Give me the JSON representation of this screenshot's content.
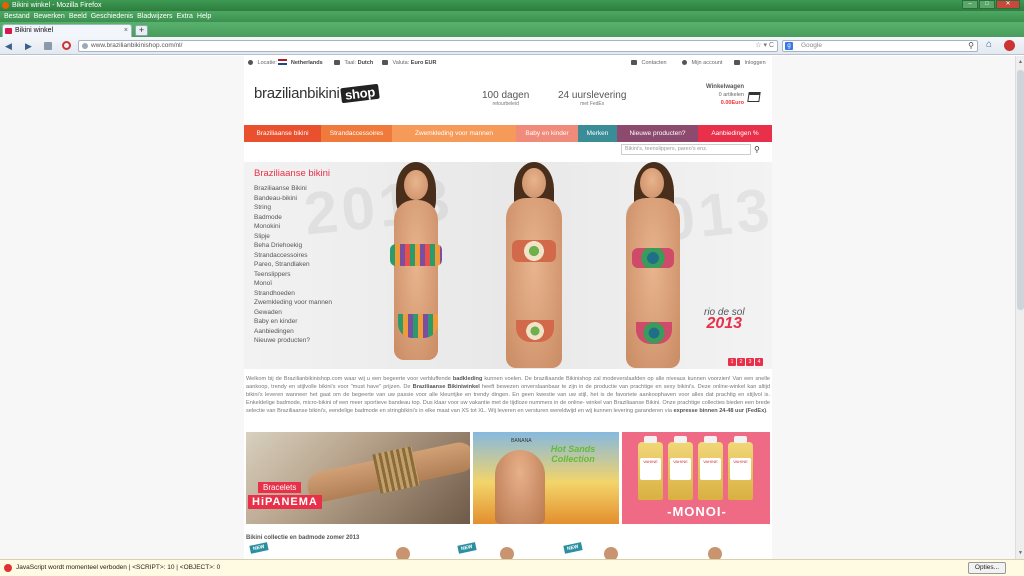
{
  "window": {
    "title": "Bikini winkel - Mozilla Firefox",
    "minimize": "–",
    "maximize": "□",
    "close": "✕"
  },
  "menu": [
    "Bestand",
    "Bewerken",
    "Beeld",
    "Geschiedenis",
    "Bladwijzers",
    "Extra",
    "Help"
  ],
  "tab": {
    "label": "Bikini winkel",
    "close": "×",
    "new_tab": "+"
  },
  "nav": {
    "back": "◀",
    "forward": "▶",
    "url": "www.brazilianbikinishop.com/nl/",
    "url_controls": "☆ ▾ C",
    "search_engine": "g",
    "search_placeholder": "Google",
    "search_btn": "⚲",
    "home": "⌂"
  },
  "site": {
    "util": {
      "locatie_label": "Locatie:",
      "locatie_value": "Netherlands",
      "taal_label": "Taal:",
      "taal_value": "Dutch",
      "valuta_label": "Valuta:",
      "valuta_value": "Euro EUR",
      "contact": "Contacten",
      "account": "Mijn account",
      "login": "Inloggen"
    },
    "logo_main": "brazilianbikini",
    "logo_shop": "shop",
    "usp1_big": "100 dagen",
    "usp1_small": "retourbeleid",
    "usp2_big": "24 uurslevering",
    "usp2_small": "met FedEx",
    "cart": {
      "title": "Winkelwagen",
      "items": "0 artikelen",
      "total": "0.00Euro"
    },
    "mainnav": [
      {
        "label": "Braziliaanse bikini",
        "color": "#e8502e"
      },
      {
        "label": "Strandaccessoires",
        "color": "#f07a3c"
      },
      {
        "label": "Zwemkleding voor mannen",
        "color": "#f59a58"
      },
      {
        "label": "Baby en kinder",
        "color": "#f08a7a"
      },
      {
        "label": "Merken",
        "color": "#3a8d96"
      },
      {
        "label": "Nieuwe producten?",
        "color": "#8c4a6e"
      },
      {
        "label": "Aanbiedingen %",
        "color": "#e8304a"
      }
    ],
    "search_placeholder": "Bikini's, teenslippers, pareo's enz.",
    "search_btn": "⚲",
    "hero": {
      "title": "Braziliaanse bikini",
      "links": [
        "Braziliaanse Bikini",
        "Bandeau-bikini",
        "String",
        "Badmode",
        "Monokini",
        "Slipje",
        "Beha Driehoekig",
        "Strandaccessoires",
        "Pareo, Strandlaken",
        "Teenslippers",
        "Monoï",
        "Strandhoeden",
        "Zwemkleding voor mannen",
        "Gewaden",
        "Baby en kinder",
        "Aanbiedingen",
        "Nieuwe producten?"
      ],
      "watermark": "2013",
      "brand_name": "rio de sol",
      "brand_year": "2013",
      "dots": [
        "1",
        "2",
        "3",
        "4"
      ]
    },
    "intro": {
      "p1": "Welkom bij de Brazilianbikinishop.com waar wij u een begeerte voor verbluffende ",
      "b1": "badkleding",
      "p2": " kunnen voelen. De braziliaande Bikinishop zal modeverslaafden op alle niveaus kunnen voorzien! Van een snelle aankoop, trendy en stijlvolle bikini's voor \"must have\" prijzen. De ",
      "b2": "Braziliaanse Bikiniwinkel",
      "p3": " heeft bewezen onverslaanbaar te zijn in de productie van prachtige en sexy bikini's. Deze online-winkel kan altijd bikini's leveren wanneer het gaat om de begeerte van uw passie voor alle kleurrijke en trendy dingen. En geen kwestie van uw stijl, het is de favoriete aankoophaven voor alles dat prachtig en stijlvol is. Enkeldelige badmode, micro-bikini of een meer sportieve bandeau top. Dus klaar voor uw vakantie met de tijdloze nummers in de online- winkel van Braziliaanse Bikini. Onze prachtige collecties bieden een brede selectie van Braziliaanse bikini's, eendelige badmode en stringbikini's in elke maat van XS tot XL. Wij leveren en versturen wereldwijd en wij kunnen levering garanderen via ",
      "b3": "expresse binnen 24-48 uur (FedEx)",
      "p4": "."
    },
    "banners": {
      "bracelets": "Bracelets",
      "hipanema": "HiPANEMA",
      "hotsands_brand": "BANANA",
      "hotsands_title": "Hot Sands Collection",
      "monoi": "-MONOI-",
      "monoi_bottle": "VAHINE"
    },
    "section_title": "Bikini collectie en badmode zomer 2013",
    "new_badge": "NEW"
  },
  "jsbar": {
    "text": "JavaScript wordt momenteel verboden | <SCRIPT>: 10 | <OBJECT>: 0",
    "options": "Opties..."
  }
}
